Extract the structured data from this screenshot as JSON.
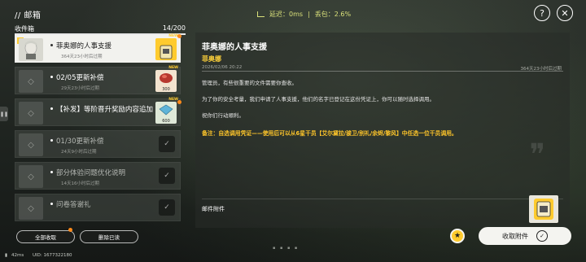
{
  "header": {
    "title": "// 邮箱",
    "latency_text": "延迟：0ms",
    "pack_loss_text": "丢包：2.6%"
  },
  "inbox": {
    "tab_label": "收件箱",
    "count": "14/200"
  },
  "mail_list": [
    {
      "title": "菲奥娜的人事支援",
      "sub": "364天23小时后过期",
      "active": true,
      "new": true,
      "star": true,
      "reward": "item"
    },
    {
      "title": "02/05更新补偿",
      "sub": "29天23小时后过期",
      "active": false,
      "new": true,
      "reward": "food",
      "reward_count": "300"
    },
    {
      "title": "【补发】等阶晋升奖励内容追加",
      "sub": "",
      "active": false,
      "new": true,
      "reward": "gem",
      "reward_count": "600"
    },
    {
      "title": "01/30更新补偿",
      "sub": "24天9小时后过期",
      "active": false,
      "claimed": true
    },
    {
      "title": "部分体验问题优化说明",
      "sub": "14天16小时后过期",
      "active": false,
      "claimed": true
    },
    {
      "title": "问卷答谢礼",
      "sub": "",
      "active": false,
      "claimed": true
    }
  ],
  "detail": {
    "title": "菲奥娜的人事支援",
    "sender": "菲奥娜",
    "date": "2026/02/06 20:22",
    "expire": "364天23小时后过期",
    "paragraphs": [
      "管理员，有些很重要的文件需要你查收。",
      "为了你的安全考量，我们申请了人事支援，他们的名字已登记在这份凭证上，你可以随时选择调用。",
      "祝你们行动顺利。"
    ],
    "note": "备注：自选调用凭证——使用后可以从6星干员【艾尔黛拉/骏卫/别礼/余烬/黎风】中任选一位干员调用。",
    "attachment_label": "邮件附件"
  },
  "actions": {
    "claim_all": "全部收取",
    "delete_read": "删除已读",
    "claim_attachment": "收取附件"
  },
  "footer": {
    "ping": "42ms",
    "uid": "UID: 1677322180"
  },
  "colors": {
    "accent_yellow": "#ffcb2e",
    "sender_yellow": "#ffd23a",
    "new_orange": "#ff8a1a"
  },
  "icons": {
    "help": "question-icon",
    "close": "close-icon",
    "star": "star-icon",
    "check": "check-icon"
  }
}
